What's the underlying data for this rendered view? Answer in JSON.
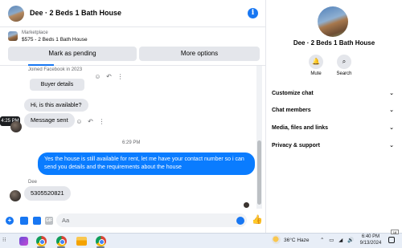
{
  "header": {
    "title": "Dee · 2 Beds 1 Bath House",
    "info_icon": "info-icon",
    "info_glyph": "i"
  },
  "listing": {
    "source": "Marketplace",
    "detail": "$575 - 2 Beds 1 Bath House",
    "pending_label": "Mark as pending",
    "more_label": "More options"
  },
  "messages": {
    "joined": "Joined Facebook in 2023",
    "buyer_details_label": "Buyer details",
    "msg_available": "Hi, is this available?",
    "msg_sent": "Message sent",
    "tooltip_time": "4:25 PM",
    "time_separator": "6:29 PM",
    "outgoing": "Yes the house is still available for rent, let me have your contact number so i can send you details and the requirements about the house",
    "sender_name": "Dee",
    "msg_number": "5305520821"
  },
  "actions": {
    "react_glyph": "☺",
    "reply_glyph": "↶",
    "more_glyph": "⋮"
  },
  "composer": {
    "placeholder": "Aa",
    "plus_glyph": "+",
    "gif_glyph": "GIF",
    "like_glyph": "👍"
  },
  "info_panel": {
    "title": "Dee · 2 Beds 1 Bath House",
    "mute_label": "Mute",
    "search_label": "Search",
    "mute_glyph": "🔔",
    "search_glyph": "⌕",
    "rows": [
      {
        "label": "Customize chat",
        "chevron": "⌄"
      },
      {
        "label": "Chat members",
        "chevron": "⌄"
      },
      {
        "label": "Media, files and links",
        "chevron": "⌄"
      },
      {
        "label": "Privacy & support",
        "chevron": "⌄"
      }
    ]
  },
  "taskbar": {
    "start_glyph": "⁝⁝",
    "weather": "36°C  Haze",
    "tray": "⌃ ▭ ◢ 🔊",
    "time": "6:40 PM",
    "date": "9/13/2024",
    "corner_badge": "18"
  },
  "colors": {
    "accent": "#1877f2",
    "outgoing_bubble": "#0a7cff",
    "incoming_bubble": "#e4e6eb"
  }
}
